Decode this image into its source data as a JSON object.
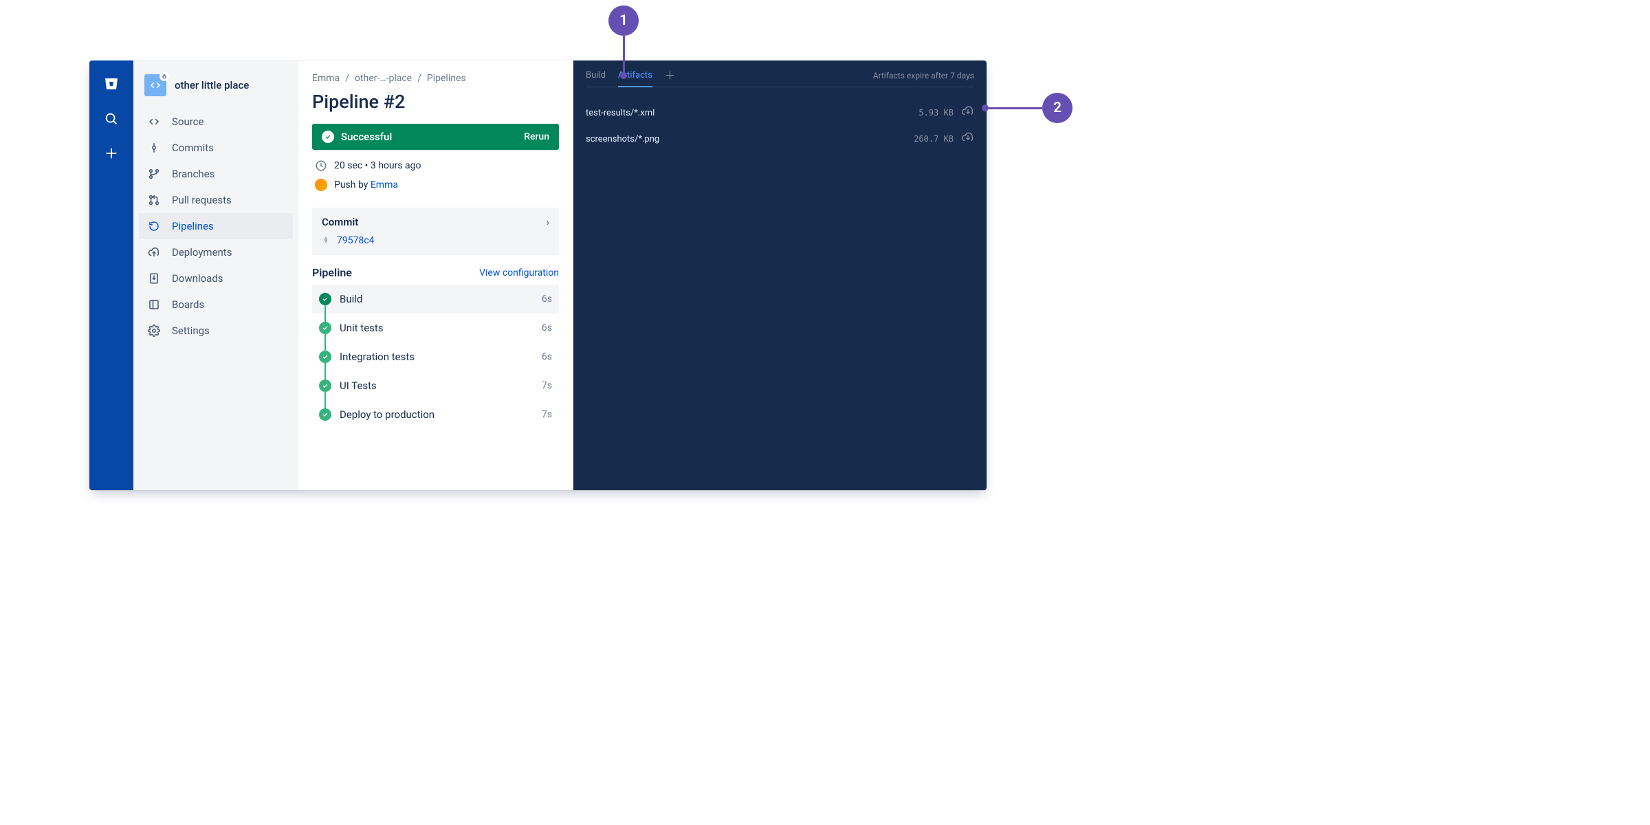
{
  "repo": {
    "name": "other little place"
  },
  "sidebar": {
    "items": [
      {
        "label": "Source"
      },
      {
        "label": "Commits"
      },
      {
        "label": "Branches"
      },
      {
        "label": "Pull requests"
      },
      {
        "label": "Pipelines"
      },
      {
        "label": "Deployments"
      },
      {
        "label": "Downloads"
      },
      {
        "label": "Boards"
      },
      {
        "label": "Settings"
      }
    ]
  },
  "breadcrumb": {
    "owner": "Emma",
    "repo": "other-…-place",
    "section": "Pipelines"
  },
  "page": {
    "title": "Pipeline #2"
  },
  "status": {
    "label": "Successful",
    "action": "Rerun"
  },
  "meta": {
    "duration_line": "20 sec • 3 hours ago",
    "push_prefix": "Push by ",
    "author": "Emma"
  },
  "commit": {
    "heading": "Commit",
    "hash": "79578c4"
  },
  "pipeline_section": {
    "heading": "Pipeline",
    "config_link": "View configuration"
  },
  "steps": [
    {
      "name": "Build",
      "duration": "6s",
      "active": true
    },
    {
      "name": "Unit tests",
      "duration": "6s"
    },
    {
      "name": "Integration tests",
      "duration": "6s"
    },
    {
      "name": "UI Tests",
      "duration": "7s"
    },
    {
      "name": "Deploy to production",
      "duration": "7s"
    }
  ],
  "panel": {
    "tabs": {
      "build": "Build",
      "artifacts": "Artifacts"
    },
    "expire_notice": "Artifacts expire after 7 days",
    "artifacts": [
      {
        "name": "test-results/*.xml",
        "size": "5.93 KB"
      },
      {
        "name": "screenshots/*.png",
        "size": "260.7 KB"
      }
    ]
  },
  "callouts": {
    "one": "1",
    "two": "2"
  }
}
